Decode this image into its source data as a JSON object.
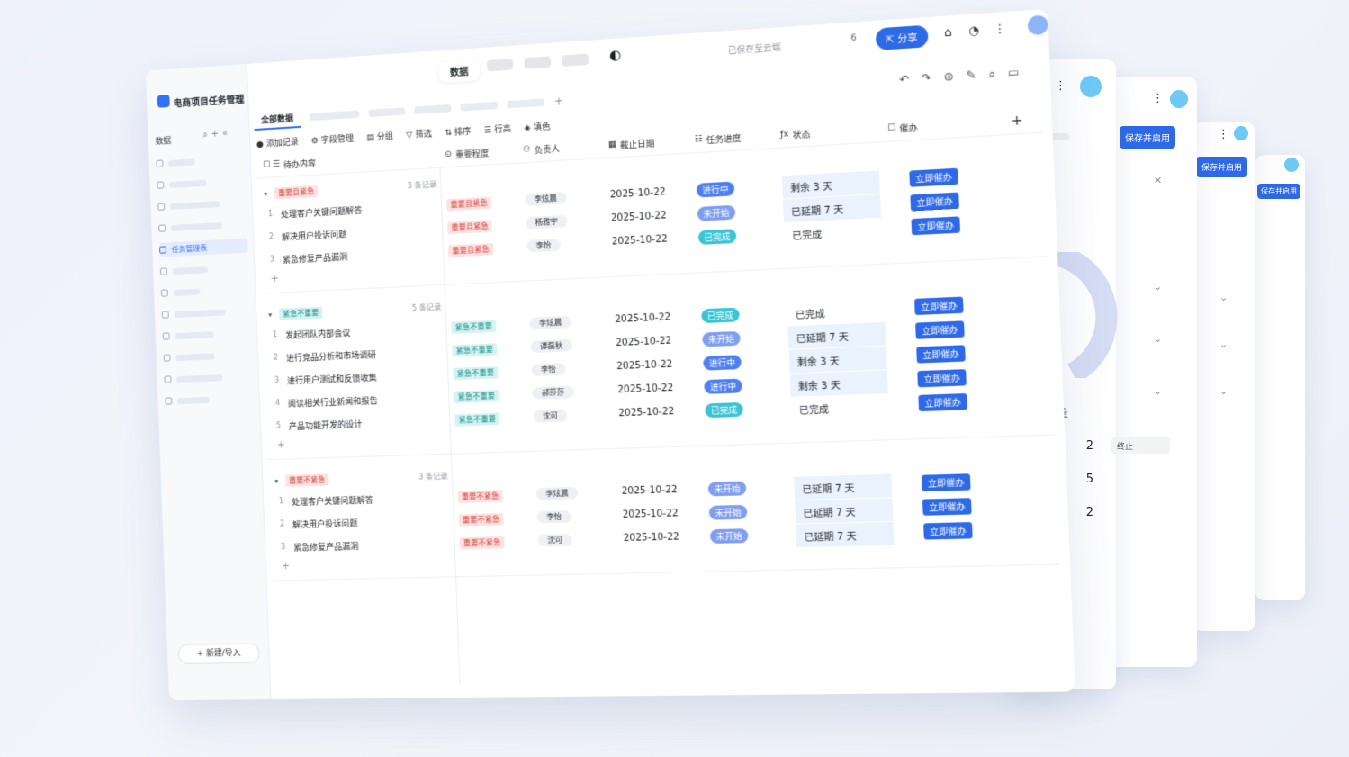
{
  "app": {
    "title": "电商项目任务管理",
    "view_tab": "数据",
    "saved_text": "已保存至云端",
    "online_count": "6",
    "share_label": "分享"
  },
  "sidebar": {
    "header": "数据",
    "active_item": "任务管理表",
    "new_button": "+ 新建/导入"
  },
  "views": {
    "active": "全部数据"
  },
  "toolbar": {
    "add_record": "添加记录",
    "field_manage": "字段管理",
    "group": "分组",
    "filter": "筛选",
    "sort": "排序",
    "row_height": "行高",
    "fill_color": "填色"
  },
  "columns": {
    "todo": "待办内容",
    "priority": "重要程度",
    "owner": "负责人",
    "deadline": "截止日期",
    "progress": "任务进度",
    "status": "状态",
    "urge": "催办"
  },
  "groups": [
    {
      "tag": "重要且紧急",
      "count": "3 条记录",
      "rows": [
        {
          "idx": "1",
          "name": "处理客户关键问题解答",
          "prio": "重要且紧急",
          "owner": "李炫晨",
          "date": "2025-10-22",
          "progress": "进行中",
          "status": "剩余 3 天",
          "urge": "立即催办"
        },
        {
          "idx": "2",
          "name": "解决用户投诉问题",
          "prio": "重要且紧急",
          "owner": "杨雅宇",
          "date": "2025-10-22",
          "progress": "未开始",
          "status": "已延期 7 天",
          "urge": "立即催办"
        },
        {
          "idx": "3",
          "name": "紧急修复产品漏洞",
          "prio": "重要且紧急",
          "owner": "李怡",
          "date": "2025-10-22",
          "progress": "已完成",
          "status": "已完成",
          "urge": "立即催办"
        }
      ]
    },
    {
      "tag": "紧急不重要",
      "count": "5 条记录",
      "rows": [
        {
          "idx": "1",
          "name": "发起团队内部会议",
          "prio": "紧急不重要",
          "owner": "李炫晨",
          "date": "2025-10-22",
          "progress": "已完成",
          "status": "已完成",
          "urge": "立即催办"
        },
        {
          "idx": "2",
          "name": "进行竞品分析和市场调研",
          "prio": "紧急不重要",
          "owner": "谭磊秋",
          "date": "2025-10-22",
          "progress": "未开始",
          "status": "已延期 7 天",
          "urge": "立即催办"
        },
        {
          "idx": "3",
          "name": "进行用户测试和反馈收集",
          "prio": "紧急不重要",
          "owner": "李怡",
          "date": "2025-10-22",
          "progress": "进行中",
          "status": "剩余 3 天",
          "urge": "立即催办"
        },
        {
          "idx": "4",
          "name": "阅读相关行业新闻和报告",
          "prio": "紧急不重要",
          "owner": "郝莎莎",
          "date": "2025-10-22",
          "progress": "进行中",
          "status": "剩余 3 天",
          "urge": "立即催办"
        },
        {
          "idx": "5",
          "name": "产品功能开发的设计",
          "prio": "紧急不重要",
          "owner": "沈可",
          "date": "2025-10-22",
          "progress": "已完成",
          "status": "已完成",
          "urge": "立即催办"
        }
      ]
    },
    {
      "tag": "重要不紧急",
      "count": "3 条记录",
      "rows": [
        {
          "idx": "1",
          "name": "处理客户关键问题解答",
          "prio": "重要不紧急",
          "owner": "李炫晨",
          "date": "2025-10-22",
          "progress": "未开始",
          "status": "已延期 7 天",
          "urge": "立即催办"
        },
        {
          "idx": "2",
          "name": "解决用户投诉问题",
          "prio": "重要不紧急",
          "owner": "李怡",
          "date": "2025-10-22",
          "progress": "未开始",
          "status": "已延期 7 天",
          "urge": "立即催办"
        },
        {
          "idx": "3",
          "name": "紧急修复产品漏洞",
          "prio": "重要不紧急",
          "owner": "沈可",
          "date": "2025-10-22",
          "progress": "未开始",
          "status": "已延期 7 天",
          "urge": "立即催办"
        }
      ]
    }
  ],
  "side_panels": {
    "save_enable": "保存并启用",
    "gauge_max": "100",
    "quantity_header": "数量",
    "quantities": [
      "2",
      "5",
      "2"
    ],
    "stop_label": "终止"
  },
  "colors": {
    "accent": "#2e6ae8",
    "tag_red": "#d83931",
    "tag_teal": "#0f8c86"
  }
}
